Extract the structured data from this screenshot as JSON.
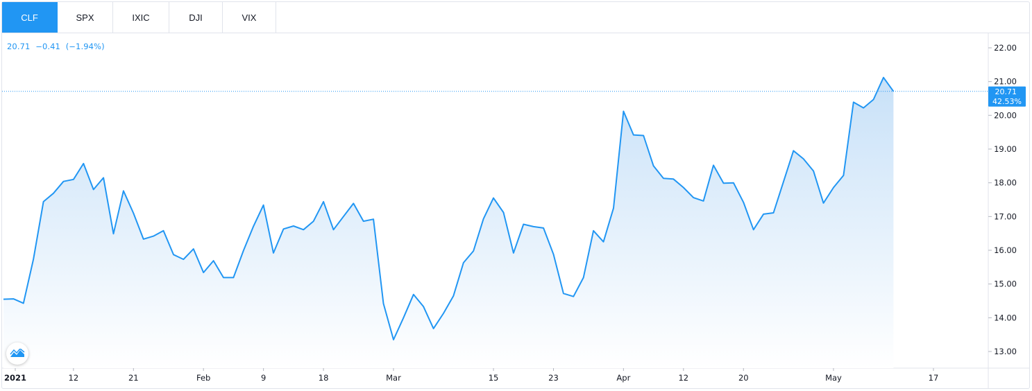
{
  "tabs": [
    {
      "label": "CLF",
      "active": true
    },
    {
      "label": "SPX",
      "active": false
    },
    {
      "label": "IXIC",
      "active": false
    },
    {
      "label": "DJI",
      "active": false
    },
    {
      "label": "VIX",
      "active": false
    }
  ],
  "legend": {
    "price": "20.71",
    "change": "−0.41",
    "change_pct": "(−1.94%)"
  },
  "last_label": {
    "price": "20.71",
    "pct": "42.53%"
  },
  "colors": {
    "line": "#2196f3",
    "fill_top": "#c8e1f8",
    "fill_bottom": "#ffffff",
    "text": "#131722",
    "axis_line": "#e0e3eb"
  },
  "chart_data": {
    "type": "area",
    "title": "",
    "xlabel": "",
    "ylabel": "",
    "ylim": [
      12.75,
      22.3
    ],
    "y_ticks": [
      "13.00",
      "14.00",
      "15.00",
      "16.00",
      "17.00",
      "18.00",
      "19.00",
      "20.00",
      "21.00",
      "22.00"
    ],
    "x_ticks": [
      {
        "label": "2021",
        "date": "2021-01-01",
        "bold": true
      },
      {
        "label": "12",
        "date": "2021-01-12"
      },
      {
        "label": "21",
        "date": "2021-01-21"
      },
      {
        "label": "Feb",
        "date": "2021-02-01"
      },
      {
        "label": "9",
        "date": "2021-02-09"
      },
      {
        "label": "18",
        "date": "2021-02-18"
      },
      {
        "label": "Mar",
        "date": "2021-03-01"
      },
      {
        "label": "15",
        "date": "2021-03-15"
      },
      {
        "label": "23",
        "date": "2021-03-23"
      },
      {
        "label": "Apr",
        "date": "2021-04-01"
      },
      {
        "label": "12",
        "date": "2021-04-12"
      },
      {
        "label": "20",
        "date": "2021-04-20"
      },
      {
        "label": "May",
        "date": "2021-05-03"
      },
      {
        "label": "17",
        "date": "2021-05-17"
      }
    ],
    "series": [
      {
        "dates": [
          "2020-12-31",
          "2021-01-04",
          "2021-01-05",
          "2021-01-06",
          "2021-01-07",
          "2021-01-08",
          "2021-01-11",
          "2021-01-12",
          "2021-01-13",
          "2021-01-14",
          "2021-01-15",
          "2021-01-19",
          "2021-01-20",
          "2021-01-21",
          "2021-01-22",
          "2021-01-25",
          "2021-01-26",
          "2021-01-27",
          "2021-01-28",
          "2021-01-29",
          "2021-02-01",
          "2021-02-02",
          "2021-02-03",
          "2021-02-04",
          "2021-02-05",
          "2021-02-08",
          "2021-02-09",
          "2021-02-10",
          "2021-02-11",
          "2021-02-12",
          "2021-02-16",
          "2021-02-17",
          "2021-02-18",
          "2021-02-19",
          "2021-02-22",
          "2021-02-23",
          "2021-02-24",
          "2021-02-25",
          "2021-02-26",
          "2021-03-01",
          "2021-03-02",
          "2021-03-03",
          "2021-03-04",
          "2021-03-05",
          "2021-03-08",
          "2021-03-09",
          "2021-03-10",
          "2021-03-11",
          "2021-03-12",
          "2021-03-15",
          "2021-03-16",
          "2021-03-17",
          "2021-03-18",
          "2021-03-19",
          "2021-03-22",
          "2021-03-23",
          "2021-03-24",
          "2021-03-25",
          "2021-03-26",
          "2021-03-29",
          "2021-03-30",
          "2021-03-31",
          "2021-04-01",
          "2021-04-05",
          "2021-04-06",
          "2021-04-07",
          "2021-04-08",
          "2021-04-09",
          "2021-04-12",
          "2021-04-13",
          "2021-04-14",
          "2021-04-15",
          "2021-04-16",
          "2021-04-19",
          "2021-04-20",
          "2021-04-21",
          "2021-04-22",
          "2021-04-23",
          "2021-04-26",
          "2021-04-27",
          "2021-04-28",
          "2021-04-29",
          "2021-04-30",
          "2021-05-03",
          "2021-05-04",
          "2021-05-05",
          "2021-05-06",
          "2021-05-07",
          "2021-05-10"
        ],
        "values": [
          14.55,
          14.56,
          14.43,
          15.74,
          17.44,
          17.69,
          18.04,
          18.1,
          18.57,
          17.8,
          18.15,
          16.49,
          17.76,
          17.1,
          16.33,
          16.42,
          16.58,
          15.87,
          15.73,
          16.04,
          15.34,
          15.69,
          15.19,
          15.19,
          15.99,
          16.71,
          17.34,
          15.92,
          16.63,
          16.72,
          16.61,
          16.86,
          17.44,
          16.61,
          17.0,
          17.39,
          16.86,
          16.92,
          14.42,
          13.35,
          14.0,
          14.69,
          14.33,
          13.68,
          14.13,
          14.65,
          15.63,
          15.98,
          16.93,
          17.55,
          17.12,
          15.92,
          16.77,
          16.7,
          16.66,
          15.88,
          14.72,
          14.63,
          15.19,
          16.58,
          16.25,
          17.25,
          20.12,
          19.42,
          19.4,
          18.5,
          18.13,
          18.11,
          17.86,
          17.56,
          17.46,
          18.52,
          17.99,
          18.0,
          17.42,
          16.61,
          17.07,
          17.11,
          18.03,
          18.95,
          18.71,
          18.35,
          17.4,
          17.86,
          18.22,
          20.39,
          20.22,
          20.47,
          21.12,
          20.71
        ]
      }
    ]
  }
}
